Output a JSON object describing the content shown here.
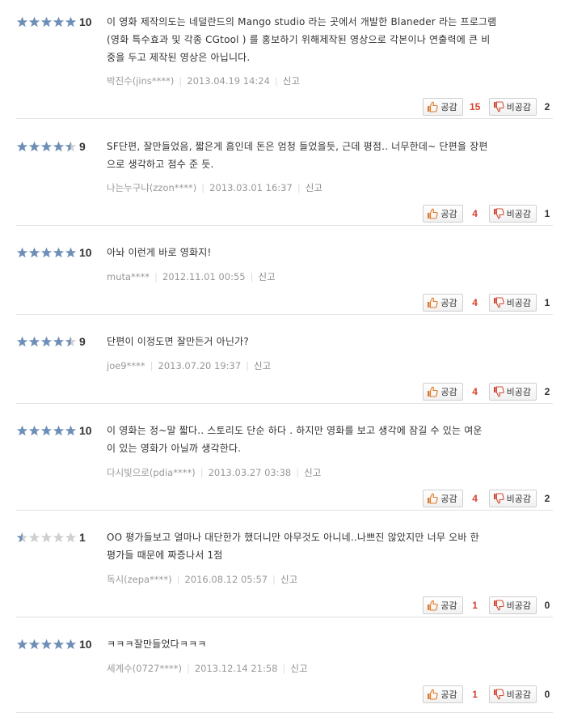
{
  "colors": {
    "star_fill": "#6d8eb7",
    "star_empty": "#cfcfcf",
    "like_count": "#d9412f",
    "like_icon": "#e07a2a",
    "dislike_icon": "#d04a33"
  },
  "icons": {
    "star": "star-icon",
    "like": "thumbs-up-icon",
    "dislike": "thumbs-down-icon"
  },
  "labels": {
    "like": "공감",
    "dislike": "비공감",
    "report": "신고"
  },
  "reviews": [
    {
      "stars": 5,
      "score": "10",
      "lines": [
        "이 영화 제작의도는 네덜란드의 Mango studio 라는 곳에서 개발한 Blaneder 라는 프로그램",
        "(영화 특수효과 및 각종 CGtool ) 를 홍보하기 위해제작된 영상으로 각본이나 연출력에 큰 비",
        "중을 두고 제작된 영상은 아닙니다."
      ],
      "author": "박진수(jins****)",
      "date": "2013.04.19 14:24",
      "likes": "15",
      "dislikes": "2"
    },
    {
      "stars": 4.5,
      "score": "9",
      "lines": [
        "SF단편, 잘만들었음, 짧은게 흠인데 돈은 엄청 들었을듯, 근데 평점.. 너무한데~ 단편을 장편",
        "으로 생각하고 점수 준 듯."
      ],
      "author": "나는누구냐(zzon****)",
      "date": "2013.03.01 16:37",
      "likes": "4",
      "dislikes": "1"
    },
    {
      "stars": 5,
      "score": "10",
      "lines": [
        "아놔 이런게 바로 영화지!"
      ],
      "author": "muta****",
      "date": "2012.11.01 00:55",
      "likes": "4",
      "dislikes": "1"
    },
    {
      "stars": 4.5,
      "score": "9",
      "lines": [
        "단편이 이정도면 잘만든거 아닌가?"
      ],
      "author": "joe9****",
      "date": "2013.07.20 19:37",
      "likes": "4",
      "dislikes": "2"
    },
    {
      "stars": 5,
      "score": "10",
      "lines": [
        "이 영화는 정~말 짧다.. 스토리도 단순 하다 . 하지만 영화를 보고 생각에 잠길 수 있는 여운",
        "이 있는 영화가 아닐까 생각한다."
      ],
      "author": "다시빛으로(pdia****)",
      "date": "2013.03.27 03:38",
      "likes": "4",
      "dislikes": "2"
    },
    {
      "stars": 0.5,
      "score": "1",
      "lines": [
        "OO 평가들보고 얼마나 대단한가 했더니만 아무것도 아니네..나쁘진 않았지만 너무 오바 한",
        "평가들 때문에 짜증나서 1점"
      ],
      "author": "독시(zepa****)",
      "date": "2016.08.12 05:57",
      "likes": "1",
      "dislikes": "0"
    },
    {
      "stars": 5,
      "score": "10",
      "lines": [
        "ㅋㅋㅋ잘만들었다ㅋㅋㅋ"
      ],
      "author": "세계수(0727****)",
      "date": "2013.12.14 21:58",
      "likes": "1",
      "dislikes": "0"
    }
  ]
}
